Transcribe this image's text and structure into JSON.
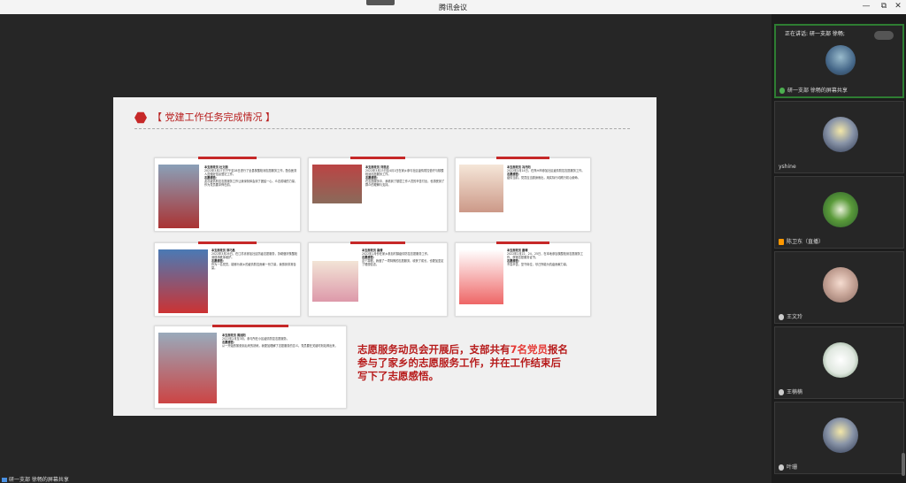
{
  "window": {
    "title": "腾讯会议",
    "controls": {
      "minimize": "—",
      "restore": "⧉",
      "close": "✕"
    }
  },
  "slide": {
    "title": "【 党建工作任务完成情况 】",
    "summary": {
      "before": "志愿服务动员会开展后，支部共有",
      "highlight": "7名党员",
      "after": "报名参与了家乡的志愿服务工作，并在工作结束后写下了志愿感悟。"
    },
    "cards": [
      {
        "name": "本支部党员 杜文丽",
        "lines": [
          "2022年3月27日下午至28日进行了全县核酸检测志愿服务工作，配合医务人员做好信息登记工作。",
          "志愿感悟：",
          "此次疫情防控志愿服务工作让我深刻体会到了团结一心、众志成城的力量，作为党员要冲锋在前。"
        ]
      },
      {
        "name": "本支部党员 刘思洁",
        "lines": [
          "2022年3月23日至4月1日在家乡参与社区疫情防控值守与核酸检测志愿服务工作。",
          "志愿感悟：",
          "在志愿服务中，我看到了基层工作人员的辛苦付出，也感受到了群众的理解与支持。"
        ]
      },
      {
        "name": "本支部党员 冯丹阳",
        "lines": [
          "2022年3月14日，在郑州市参加社区疫情防控志愿服务工作。",
          "志愿感悟：",
          "疫情当前，党员应当挺身而出，用实际行动践行初心使命。"
        ]
      },
      {
        "name": "本支部党员 郑巧昌",
        "lines": [
          "2022年3月26日，在江苏省参加社区防疫志愿服务，协助做好核酸检测现场秩序维护。",
          "志愿感悟：",
          "作为一名党员，能够为家乡的疫情防控贡献一份力量，我感到非常自豪。"
        ]
      },
      {
        "name": "本支部党员 高倩",
        "lines": [
          "2022年1月份在家乡参加村镇疫情防控志愿服务工作。",
          "志愿感悟：",
          "这个寒假，我做了一项特殊的志愿服务，收获了成长，也更加坚定了理想信念。"
        ]
      },
      {
        "name": "本支部党员 唐晴",
        "lines": [
          "2022年2月22、24、25日，在本地参加核酸检测志愿服务工作，获得志愿服务证书。",
          "志愿感悟：",
          "不畏辛苦，坚守岗位，尽己所能为抗疫贡献力量。"
        ]
      },
      {
        "name": "本支部党员 周旭阳",
        "lines": [
          "2022年2月至3月，参与所在小区疫情防控志愿服务。",
          "志愿感悟：",
          "从一开始的紧张到后来的熟练，我更加理解了志愿服务的意义。党员要在关键时刻站得出来。"
        ]
      }
    ]
  },
  "participants": {
    "speaking_prefix": "正在讲话:",
    "speaking_name": "研一支部 徐畅;",
    "tiles": [
      {
        "name": "研一支部 徐畅的屏幕共享",
        "avatar": "lake-landscape",
        "active": true
      },
      {
        "name": "yshine",
        "avatar": "night-sky",
        "active": false
      },
      {
        "name": "陈卫东（直播）",
        "avatar": "green-leaves",
        "active": false
      },
      {
        "name": "王文玲",
        "avatar": "portrait",
        "active": false
      },
      {
        "name": "王楠楠",
        "avatar": "plant-sketch",
        "active": false
      },
      {
        "name": "叶珊",
        "avatar": "night-sky",
        "active": false
      }
    ]
  },
  "share_status": "研一支部 徐畅的屏幕共享"
}
